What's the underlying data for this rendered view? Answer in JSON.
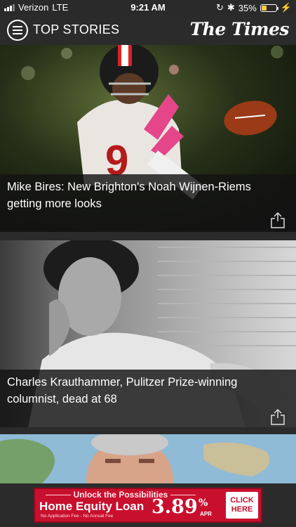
{
  "status_bar": {
    "carrier": "Verizon",
    "network": "LTE",
    "time": "9:21 AM",
    "battery": "35%",
    "battery_level": 0.35
  },
  "header": {
    "title": "TOP STORIES",
    "logo": "The Times"
  },
  "stories": [
    {
      "headline": "Mike Bires: New Brighton's Noah Wijnen-Riems getting more looks"
    },
    {
      "headline": "Charles Krauthammer, Pulitzer Prize-winning columnist, dead at 68"
    },
    {
      "headline": ""
    }
  ],
  "ad": {
    "tagline": "Unlock the Possibilities",
    "product": "Home Equity Loan",
    "rate": "3.89",
    "percent": "%",
    "rate_label": "APR",
    "fine_print": "No Application Fee - No Annual Fee",
    "cta_line1": "CLICK",
    "cta_line2": "HERE"
  },
  "colors": {
    "background": "#2b2b2b",
    "ad_red": "#c8102e",
    "battery": "#f6c945"
  }
}
